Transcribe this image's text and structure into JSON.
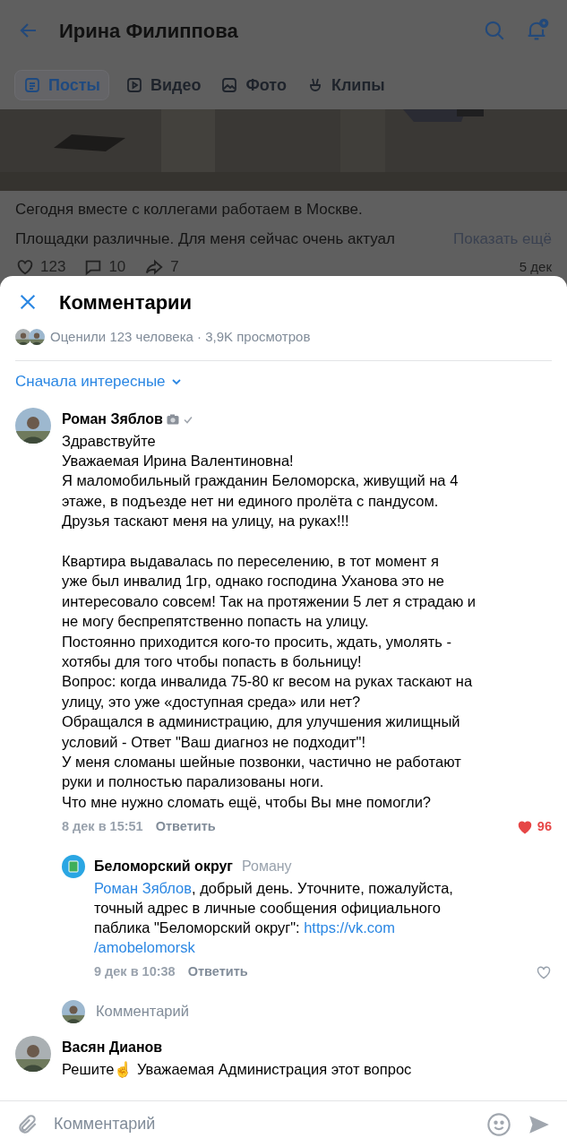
{
  "header": {
    "title": "Ирина Филиппова"
  },
  "tabs": [
    {
      "label": "Посты",
      "selected": true,
      "kind": "posts"
    },
    {
      "label": "Видео",
      "selected": false,
      "kind": "video"
    },
    {
      "label": "Фото",
      "selected": false
    },
    {
      "label": "Клипы",
      "selected": false,
      "kind": "clips"
    }
  ],
  "post": {
    "lines": [
      "Сегодня вместе с коллегами работаем в Москве.",
      "Площадки различные. Для меня сейчас очень актуал"
    ],
    "more": "Показать ещё",
    "likes": "123",
    "comments": "10",
    "shares": "7",
    "date": "5 дек"
  },
  "sheet": {
    "title": "Комментарии",
    "stats": "Оценили 123 человека · 3,9K просмотров",
    "sort": "Сначала интересные",
    "comments": [
      {
        "author": "Роман Зяблов",
        "camera_badge": true,
        "verified": true,
        "text": "Здравствуйте\nУважаемая Ирина Валентиновна!\nЯ маломобильный гражданин Беломорска, живущий на 4\nэтаже, в подъезде нет ни единого пролёта с пандусом.\nДрузья таскают меня на улицу, на руках!!!\n\nКвартира выдавалась по переселению, в тот момент я\nуже был инвалид 1гр, однако господина Уханова это не\nинтересовало совсем! Так на протяжении 5 лет я страдаю и\nне могу беспрепятственно попасть на улицу.\nПостоянно приходится кого-то просить, ждать, умолять -\nхотябы для того чтобы попасть в больницу!\nВопрос: когда инвалида 75-80 кг весом на руках таскают на\nулицу, это уже «доступная среда» или нет?\nОбращался в администрацию, для улучшения жилищный\nусловий - Ответ \"Ваш диагноз не подходит\"!\nУ меня сломаны шейные позвонки, частично не работают\nруки и полностью парализованы ноги.\nЧто мне нужно сломать ещё, чтобы Вы мне помогли?",
        "date": "8 дек в 15:51",
        "reply_label": "Ответить",
        "likes": "96",
        "liked": true,
        "replies": [
          {
            "author": "Беломорский округ",
            "to": "Роману",
            "segments": [
              {
                "kind": "mention",
                "text": "Роман Зяблов"
              },
              {
                "kind": "text",
                "text": ", добрый день. Уточните, пожалуйста,\nточный адрес в личные сообщения официального\nпаблика \"Беломорский округ\": "
              },
              {
                "kind": "link",
                "text": "https://vk.com"
              },
              {
                "kind": "break"
              },
              {
                "kind": "link",
                "text": "/amobelomorsk"
              }
            ],
            "date": "9 дек в 10:38",
            "reply_label": "Ответить",
            "liked": false
          }
        ],
        "reply_prompt": "Комментарий"
      },
      {
        "author": "Васян Дианов",
        "camera_badge": false,
        "verified": false,
        "text": "Решите☝ Уважаемая Администрация этот вопрос"
      }
    ]
  },
  "composer": {
    "placeholder": "Комментарий"
  }
}
